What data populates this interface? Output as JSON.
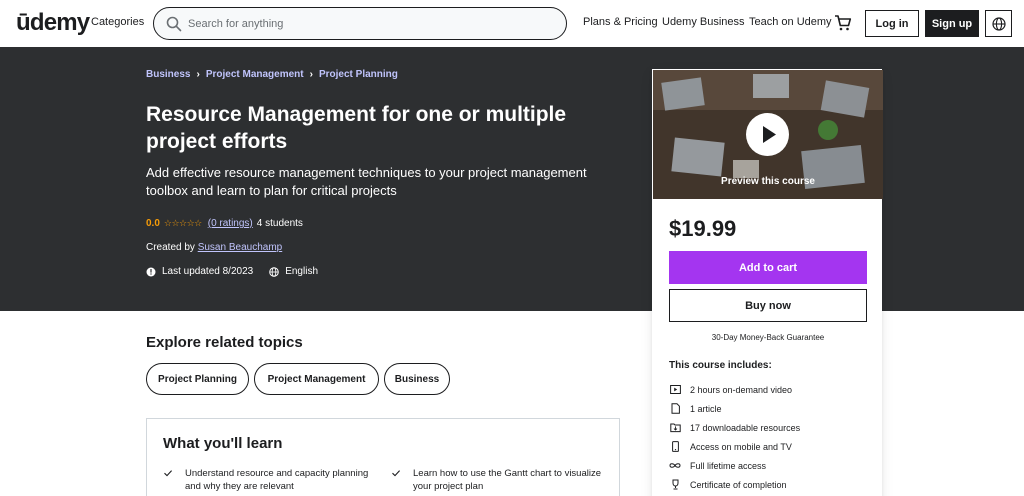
{
  "header": {
    "logo": "ūdemy",
    "categories": "Categories",
    "search_placeholder": "Search for anything",
    "nav": [
      "Plans & Pricing",
      "Udemy Business",
      "Teach on Udemy"
    ],
    "login": "Log in",
    "signup": "Sign up"
  },
  "hero": {
    "breadcrumb": [
      "Business",
      "Project Management",
      "Project Planning"
    ],
    "title": "Resource Management for one or multiple project efforts",
    "subtitle": "Add effective resource management techniques to your project management toolbox and learn to plan for critical projects",
    "rating": "0.0",
    "ratings_count": "(0 ratings)",
    "students": "4 students",
    "created_by_label": "Created by",
    "instructor": "Susan Beauchamp",
    "last_updated": "Last updated 8/2023",
    "language": "English"
  },
  "card": {
    "preview_label": "Preview this course",
    "price": "$19.99",
    "add_to_cart": "Add to cart",
    "buy_now": "Buy now",
    "guarantee": "30-Day Money-Back Guarantee",
    "includes_title": "This course includes:",
    "includes": [
      {
        "icon": "video-icon",
        "text": "2 hours on-demand video"
      },
      {
        "icon": "article-icon",
        "text": "1 article"
      },
      {
        "icon": "download-icon",
        "text": "17 downloadable resources"
      },
      {
        "icon": "mobile-icon",
        "text": "Access on mobile and TV"
      },
      {
        "icon": "infinity-icon",
        "text": "Full lifetime access"
      },
      {
        "icon": "trophy-icon",
        "text": "Certificate of completion"
      }
    ]
  },
  "explore": {
    "title": "Explore related topics",
    "topics": [
      "Project Planning",
      "Project Management",
      "Business"
    ]
  },
  "learn": {
    "title": "What you'll learn",
    "items": [
      "Understand resource and capacity planning and why they are relevant",
      "Learn how to use the Gantt chart to visualize your project plan"
    ]
  },
  "colors": {
    "accent": "#a435f0",
    "hero_bg": "#2d2f31",
    "link": "#c0c4fc",
    "star": "#f69c08"
  }
}
